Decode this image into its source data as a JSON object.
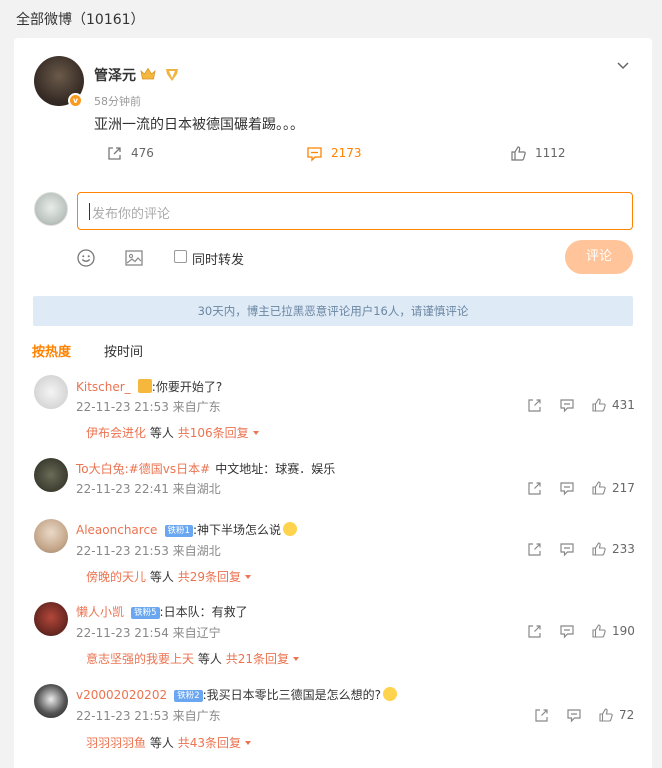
{
  "page": {
    "title": "全部微博（10161）"
  },
  "post": {
    "author": "管泽元",
    "time": "58分钟前",
    "content": "亚洲一流的日本被德国碾着踢。。。",
    "reposts": "476",
    "comments": "2173",
    "likes": "1112"
  },
  "composer": {
    "placeholder": "发布你的评论",
    "also_repost": "同时转发",
    "submit": "评论"
  },
  "notice": "30天内，博主已拉黑恶意评论用户16人，请谨慎评论",
  "tabs": [
    "按热度",
    "按时间"
  ],
  "colors": {
    "accent": "#ff8200",
    "name": "#eb7350",
    "notice_bg": "#deeaf6"
  },
  "comments": [
    {
      "name": "Kitscher_",
      "text": ":你要开始了?",
      "meta": "22-11-23 21:53 来自广东",
      "replier": "伊布会进化",
      "replies_pre": "等人",
      "replies": "共106条回复",
      "likes": "431"
    },
    {
      "name": "To大白兔:#德国vs日本#",
      "text": "中文地址：球赛．娱乐",
      "meta": "22-11-23 22:41 来自湖北",
      "likes": "217"
    },
    {
      "name": "Aleaoncharce",
      "level": "铁粉1",
      "text": ":神下半场怎么说",
      "meta": "22-11-23 21:53 来自湖北",
      "replier": "傍晚的天儿",
      "replies_pre": "等人",
      "replies": "共29条回复",
      "likes": "233"
    },
    {
      "name": "懒人小凯",
      "level": "铁粉5",
      "text": ":日本队：有救了",
      "meta": "22-11-23 21:54 来自辽宁",
      "replier": "意志坚强的我要上天",
      "replies_pre": "等人",
      "replies": "共21条回复",
      "likes": "190"
    },
    {
      "name": "v20002020202",
      "level": "铁粉2",
      "text": ":我买日本零比三德国是怎么想的?",
      "meta": "22-11-23 21:53 来自广东",
      "replier": "羽羽羽羽鱼",
      "replies_pre": "等人",
      "replies": "共43条回复",
      "likes": "72"
    }
  ]
}
